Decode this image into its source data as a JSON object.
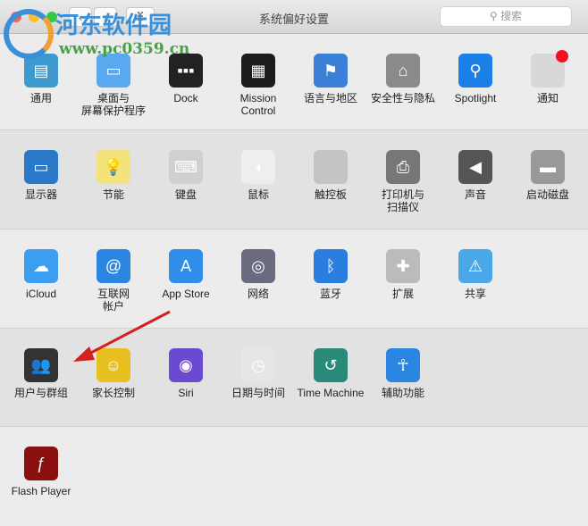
{
  "window": {
    "title": "系统偏好设置",
    "search_placeholder": "搜索",
    "back": "‹",
    "forward": "›",
    "grid": "⠿"
  },
  "watermark": {
    "name": "河东软件园",
    "url": "www.pc0359.cn"
  },
  "rows": [
    [
      {
        "label": "通用",
        "icon": "general-icon",
        "color": "#3d9ad1"
      },
      {
        "label": "桌面与\n屏幕保护程序",
        "icon": "desktop-icon",
        "color": "#5aa8f0"
      },
      {
        "label": "Dock",
        "icon": "dock-icon",
        "color": "#222222"
      },
      {
        "label": "Mission\nControl",
        "icon": "mission-control-icon",
        "color": "#1c1c1c"
      },
      {
        "label": "语言与地区",
        "icon": "flag-icon",
        "color": "#3c7fd6"
      },
      {
        "label": "安全性与隐私",
        "icon": "security-house-icon",
        "color": "#8a8a8a"
      },
      {
        "label": "Spotlight",
        "icon": "spotlight-icon",
        "color": "#1a7fe8"
      },
      {
        "label": "通知",
        "icon": "notifications-icon",
        "color": "#d8d8d8"
      }
    ],
    [
      {
        "label": "显示器",
        "icon": "display-icon",
        "color": "#2a78c8"
      },
      {
        "label": "节能",
        "icon": "bulb-icon",
        "color": "#f4e27a"
      },
      {
        "label": "键盘",
        "icon": "keyboard-icon",
        "color": "#d0d0d0"
      },
      {
        "label": "鼠标",
        "icon": "mouse-icon",
        "color": "#eeeeee"
      },
      {
        "label": "触控板",
        "icon": "trackpad-icon",
        "color": "#c4c4c4"
      },
      {
        "label": "打印机与\n扫描仪",
        "icon": "printer-icon",
        "color": "#777777"
      },
      {
        "label": "声音",
        "icon": "speaker-icon",
        "color": "#555555"
      },
      {
        "label": "启动磁盘",
        "icon": "disk-icon",
        "color": "#999999"
      }
    ],
    [
      {
        "label": "iCloud",
        "icon": "icloud-icon",
        "color": "#3b9ef0"
      },
      {
        "label": "互联网\n帐户",
        "icon": "at-icon",
        "color": "#2a86e0"
      },
      {
        "label": "App Store",
        "icon": "app-store-icon",
        "color": "#2f8ee8"
      },
      {
        "label": "网络",
        "icon": "globe-icon",
        "color": "#6a6a80"
      },
      {
        "label": "蓝牙",
        "icon": "bluetooth-icon",
        "color": "#2a7ee0"
      },
      {
        "label": "扩展",
        "icon": "puzzle-icon",
        "color": "#bbbbbb"
      },
      {
        "label": "共享",
        "icon": "sharing-folder-icon",
        "color": "#4aa8e8"
      }
    ],
    [
      {
        "label": "用户与群组",
        "icon": "users-icon",
        "color": "#333333"
      },
      {
        "label": "家长控制",
        "icon": "parental-icon",
        "color": "#e8c020"
      },
      {
        "label": "Siri",
        "icon": "siri-icon",
        "color": "#6a4ad0"
      },
      {
        "label": "日期与时间",
        "icon": "clock-icon",
        "color": "#e6e6e6"
      },
      {
        "label": "Time Machine",
        "icon": "time-machine-icon",
        "color": "#2a8a7a"
      },
      {
        "label": "辅助功能",
        "icon": "accessibility-icon",
        "color": "#2a86e0"
      }
    ],
    [
      {
        "label": "Flash Player",
        "icon": "flash-icon",
        "color": "#8a1010"
      }
    ]
  ],
  "glyphs": {
    "general-icon": "▤",
    "desktop-icon": "▭",
    "dock-icon": "▪▪▪",
    "mission-control-icon": "▦",
    "flag-icon": "⚑",
    "security-house-icon": "⌂",
    "spotlight-icon": "⚲",
    "notifications-icon": "",
    "display-icon": "▭",
    "bulb-icon": "💡",
    "keyboard-icon": "⌨",
    "mouse-icon": "◖",
    "trackpad-icon": "",
    "printer-icon": "⎙",
    "speaker-icon": "◀",
    "disk-icon": "▬",
    "icloud-icon": "☁",
    "at-icon": "@",
    "app-store-icon": "A",
    "globe-icon": "◎",
    "bluetooth-icon": "ᛒ",
    "puzzle-icon": "✚",
    "sharing-folder-icon": "⚠",
    "users-icon": "👥",
    "parental-icon": "☺",
    "siri-icon": "◉",
    "clock-icon": "◷",
    "time-machine-icon": "↺",
    "accessibility-icon": "☥",
    "flash-icon": "ƒ"
  }
}
